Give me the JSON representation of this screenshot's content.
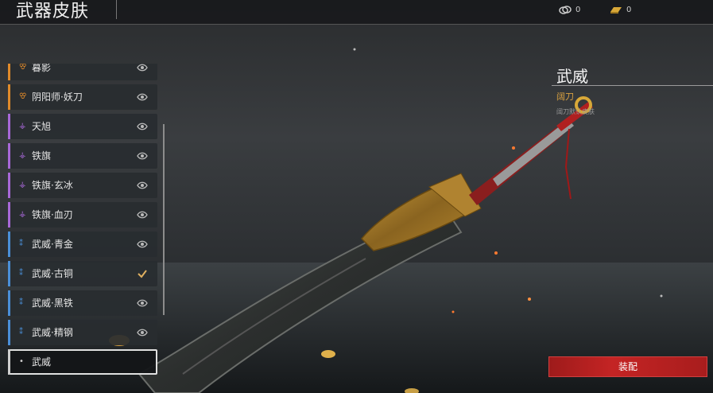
{
  "header": {
    "title": "武器皮肤",
    "currency_a": "0",
    "currency_b": "0"
  },
  "skins": [
    {
      "label": "暮影",
      "rarity": "legendary",
      "status": "eye-icon"
    },
    {
      "label": "阴阳师·妖刀",
      "rarity": "legendary",
      "status": "eye-icon"
    },
    {
      "label": "天旭",
      "rarity": "epic",
      "status": "eye-icon"
    },
    {
      "label": "铁旗",
      "rarity": "epic",
      "status": "eye-icon"
    },
    {
      "label": "铁旗·玄冰",
      "rarity": "epic",
      "status": "eye-icon"
    },
    {
      "label": "铁旗·血刃",
      "rarity": "epic",
      "status": "eye-icon"
    },
    {
      "label": "武威·青金",
      "rarity": "rare",
      "status": "eye-icon"
    },
    {
      "label": "武威·古铜",
      "rarity": "rare",
      "status": "check-icon"
    },
    {
      "label": "武威·黑铁",
      "rarity": "rare",
      "status": "eye-icon"
    },
    {
      "label": "武威·精钢",
      "rarity": "rare",
      "status": "eye-icon"
    },
    {
      "label": "武威",
      "rarity": "common",
      "status": "none",
      "selected": true
    }
  ],
  "detail": {
    "name": "武威",
    "weapon_type": "阔刀",
    "description": "阔刀默认皮肤",
    "equip_label": "装配"
  },
  "colors": {
    "legendary": "#e08a2a",
    "epic": "#a868d8",
    "rare": "#4a8fd8",
    "common": "#cfcfcf",
    "accent": "#c42424",
    "gold": "#d8a040"
  }
}
